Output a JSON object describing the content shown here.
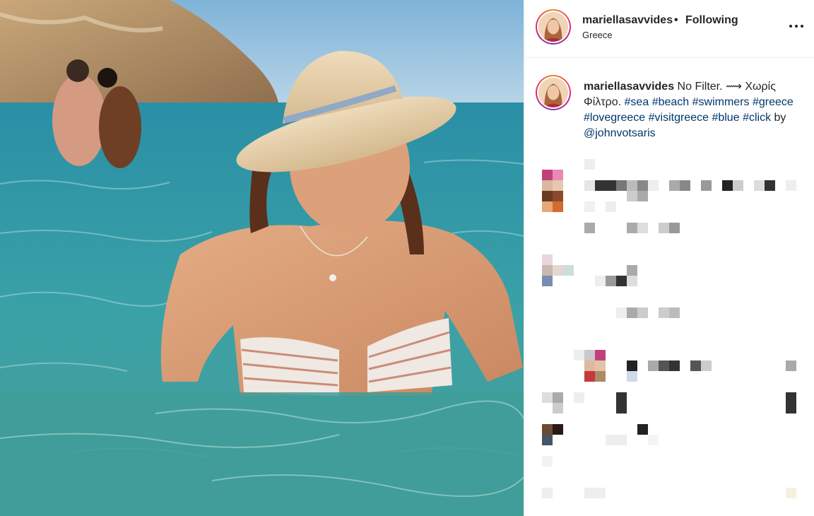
{
  "post": {
    "username": "mariellasavvides",
    "separator": "•",
    "follow_status": "Following",
    "location": "Greece",
    "more_icon": "more-options-icon"
  },
  "caption": {
    "username": "mariellasavvides",
    "text_pre": " No Filter. ",
    "emoji": "⟿",
    "text_greek": " Χωρίς Φίλτρο. ",
    "hashtags": [
      "#sea",
      "#beach",
      "#swimmers",
      "#greece",
      "#lovegreece",
      "#visitgreece",
      "#blue",
      "#click"
    ],
    "by_text": " by ",
    "mention": "@johnvotsaris"
  },
  "colors": {
    "link": "#00376b",
    "text": "#262626",
    "divider": "#efefef"
  }
}
